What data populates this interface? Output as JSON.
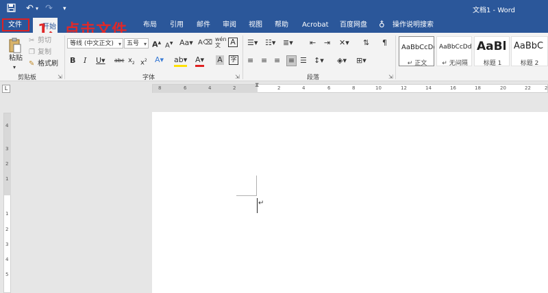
{
  "titlebar": {
    "save_icon": "save-icon",
    "undo_icon": "undo-icon",
    "redo_icon": "redo-icon",
    "customize_icon": "customize-quick-access-icon",
    "title": "文档1  -  Word"
  },
  "tabs": {
    "file": "文件",
    "home": "开始",
    "layout": "布局",
    "references": "引用",
    "mailings": "邮件",
    "review": "审阅",
    "view": "视图",
    "help": "帮助",
    "acrobat": "Acrobat",
    "baidu": "百度网盘",
    "tell_me": "操作说明搜索"
  },
  "annotation": "1、点击文件",
  "clipboard": {
    "paste": "粘贴",
    "cut": "剪切",
    "copy": "复制",
    "format_painter": "格式刷",
    "group_label": "剪贴板"
  },
  "font": {
    "font_name": "等线 (中文正文)",
    "font_size": "五号",
    "group_label": "字体"
  },
  "paragraph": {
    "group_label": "段落"
  },
  "styles": [
    {
      "sample": "AaBbCcDd",
      "name": "↵ 正文"
    },
    {
      "sample": "AaBbCcDd",
      "name": "↵ 无间隔"
    },
    {
      "sample": "AaBl",
      "name": "标题 1"
    },
    {
      "sample": "AaBbC",
      "name": "标题 2"
    }
  ],
  "ruler": {
    "h_ticks": [
      "8",
      "6",
      "4",
      "2",
      "2",
      "4",
      "6",
      "8",
      "10",
      "12",
      "14",
      "16",
      "18",
      "20",
      "22",
      "24"
    ],
    "v_ticks": [
      "4",
      "3",
      "2",
      "1",
      "1",
      "2",
      "3",
      "4",
      "5"
    ],
    "corner": "L"
  },
  "document": {
    "paragraph_mark": "↵"
  },
  "colors": {
    "accent": "#2b579a",
    "annotation": "#e02828",
    "ribbon_bg": "#f3f3f3"
  }
}
